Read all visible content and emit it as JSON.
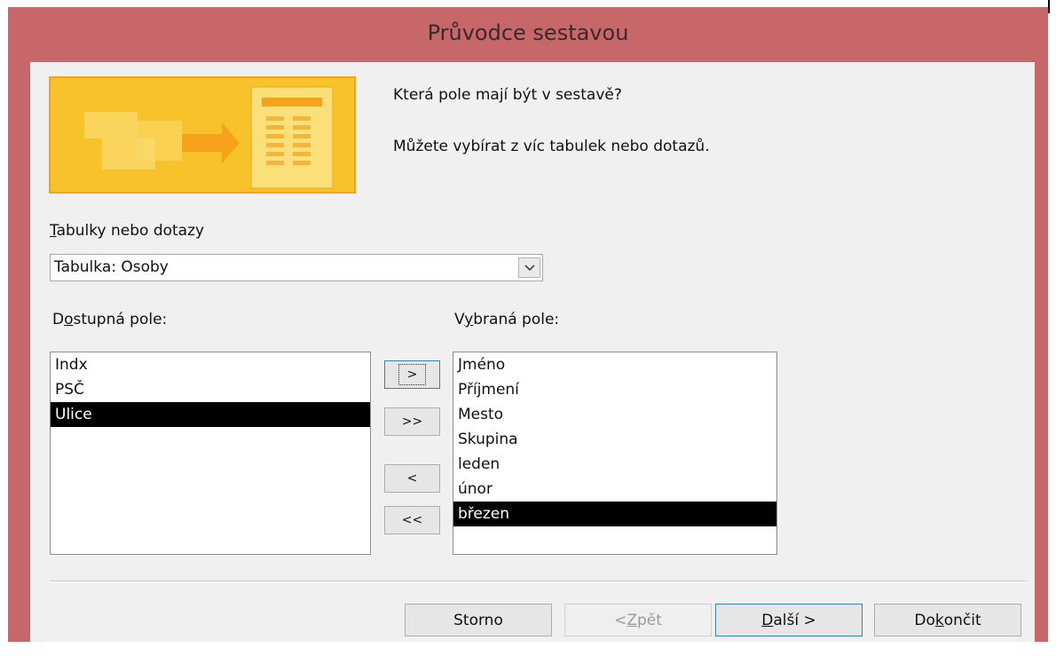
{
  "window": {
    "title": "Průvodce sestavou"
  },
  "header": {
    "question": "Která pole mají být v sestavě?",
    "hint": "Můžete vybírat z víc tabulek nebo dotazů."
  },
  "source": {
    "label_accel": "T",
    "label_rest": "abulky nebo dotazy",
    "selected": "Tabulka: Osoby"
  },
  "available": {
    "label_pre": "D",
    "label_accel": "o",
    "label_rest": "stupná pole:",
    "items": [
      "Indx",
      "PSČ",
      "Ulice"
    ],
    "selected_index": 2
  },
  "selected_fields": {
    "label_pre": "V",
    "label_accel": "y",
    "label_rest": "braná pole:",
    "items": [
      "Jméno",
      "Příjmení",
      "Mesto",
      "Skupina",
      "leden",
      "únor",
      "březen"
    ],
    "selected_index": 6
  },
  "move_buttons": {
    "add_one": ">",
    "add_all": ">>",
    "remove_one": "<",
    "remove_all": "<<"
  },
  "footer": {
    "cancel": "Storno",
    "back_pre": "< ",
    "back_accel": "Z",
    "back_rest": "pět",
    "next_accel": "D",
    "next_rest": "alší >",
    "finish_pre": "Do",
    "finish_accel": "k",
    "finish_rest": "ončit"
  },
  "colors": {
    "frame": "#c8676a",
    "client": "#f0f0f0",
    "selection": "#000000",
    "accent": "#f5b800"
  }
}
